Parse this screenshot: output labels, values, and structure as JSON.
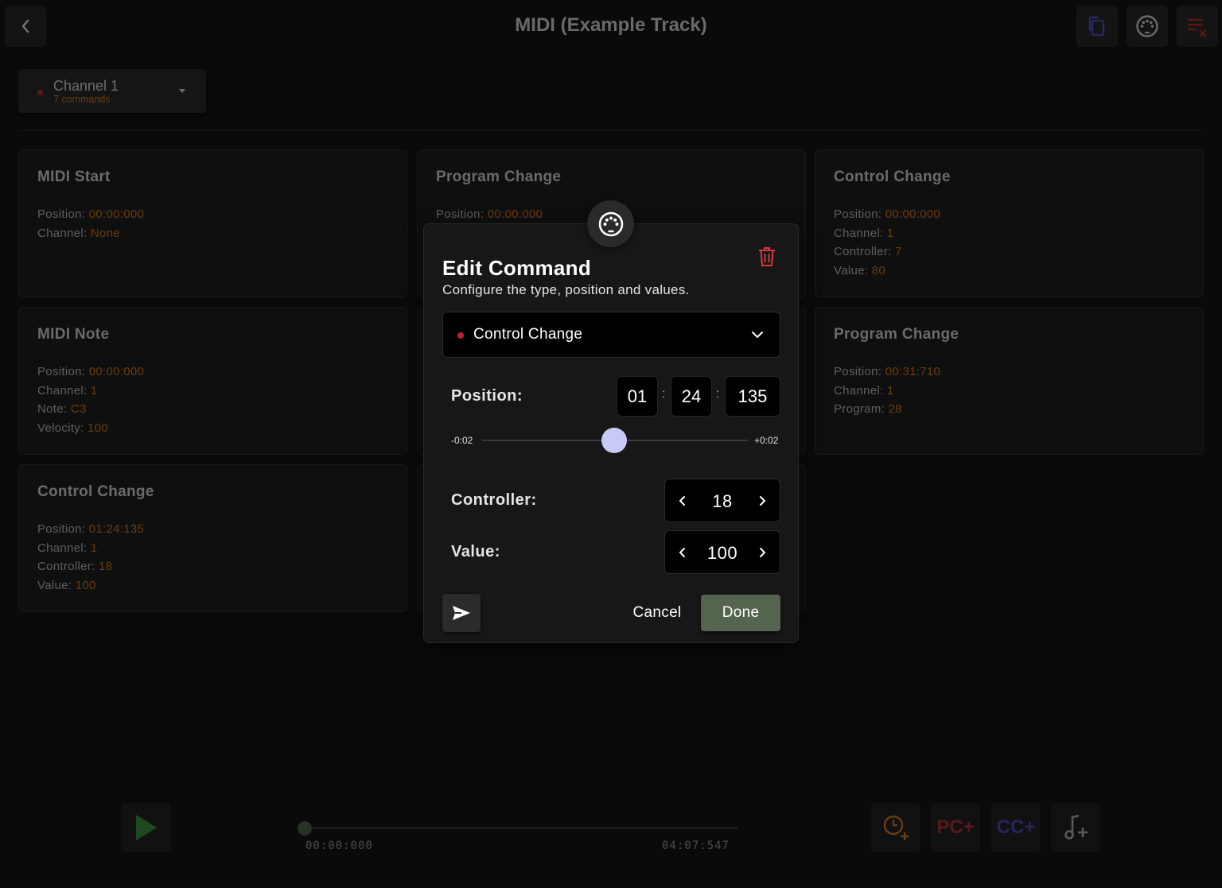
{
  "header": {
    "title": "MIDI (Example Track)",
    "back_icon": "chevron-left-icon",
    "actions": [
      "copy-icon",
      "midi-port-icon",
      "clear-list-icon"
    ]
  },
  "channel": {
    "name": "Channel 1",
    "count": "7 commands"
  },
  "cards": [
    {
      "title": "MIDI Start",
      "rows": [
        {
          "label": "Position:",
          "value": "00:00:000"
        },
        {
          "label": "Channel:",
          "value": "None"
        }
      ]
    },
    {
      "title": "Program Change",
      "rows": [
        {
          "label": "Position:",
          "value": "00:00:000"
        }
      ]
    },
    {
      "title": "Control Change",
      "rows": [
        {
          "label": "Position:",
          "value": "00:00:000"
        },
        {
          "label": "Channel:",
          "value": "1"
        },
        {
          "label": "Controller:",
          "value": "7"
        },
        {
          "label": "Value:",
          "value": "80"
        }
      ]
    },
    {
      "title": "MIDI Note",
      "rows": [
        {
          "label": "Position:",
          "value": "00:00:000"
        },
        {
          "label": "Channel:",
          "value": "1"
        },
        {
          "label": "Note:",
          "value": "C3"
        },
        {
          "label": "Velocity:",
          "value": "100"
        }
      ]
    },
    {
      "title": "Program Change",
      "rows": [
        {
          "label": "Position:",
          "value": "00:31:710"
        },
        {
          "label": "Channel:",
          "value": "1"
        },
        {
          "label": "Program:",
          "value": "28"
        }
      ]
    },
    {
      "title": "Control Change",
      "rows": [
        {
          "label": "Position:",
          "value": "01:24:135"
        },
        {
          "label": "Channel:",
          "value": "1"
        },
        {
          "label": "Controller:",
          "value": "18"
        },
        {
          "label": "Value:",
          "value": "100"
        }
      ]
    }
  ],
  "transport": {
    "start_time": "00:00:000",
    "end_time": "04:07:547",
    "progress": 0,
    "tools": [
      {
        "label": "",
        "icon": "clock-plus-icon"
      },
      {
        "label": "PC+",
        "color": "#5a1a1a"
      },
      {
        "label": "CC+",
        "color": "#26265a"
      },
      {
        "label": "",
        "icon": "note-plus-icon"
      }
    ]
  },
  "modal": {
    "title": "Edit Command",
    "subtitle": "Configure the type, position and values.",
    "type": "Control Change",
    "position_label": "Position:",
    "position": {
      "minutes": "01",
      "seconds": "24",
      "millis": "135"
    },
    "slider": {
      "min_label": "-0:02",
      "max_label": "+0:02",
      "value": 0.5
    },
    "controller_label": "Controller:",
    "controller": "18",
    "value_label": "Value:",
    "value": "100",
    "cancel": "Cancel",
    "done": "Done"
  },
  "colors": {
    "accent_red": "#c0202b",
    "slider_knob": "#c9c9f6",
    "done_button": "#55644f",
    "dim_orange": "#6a3d0e"
  }
}
